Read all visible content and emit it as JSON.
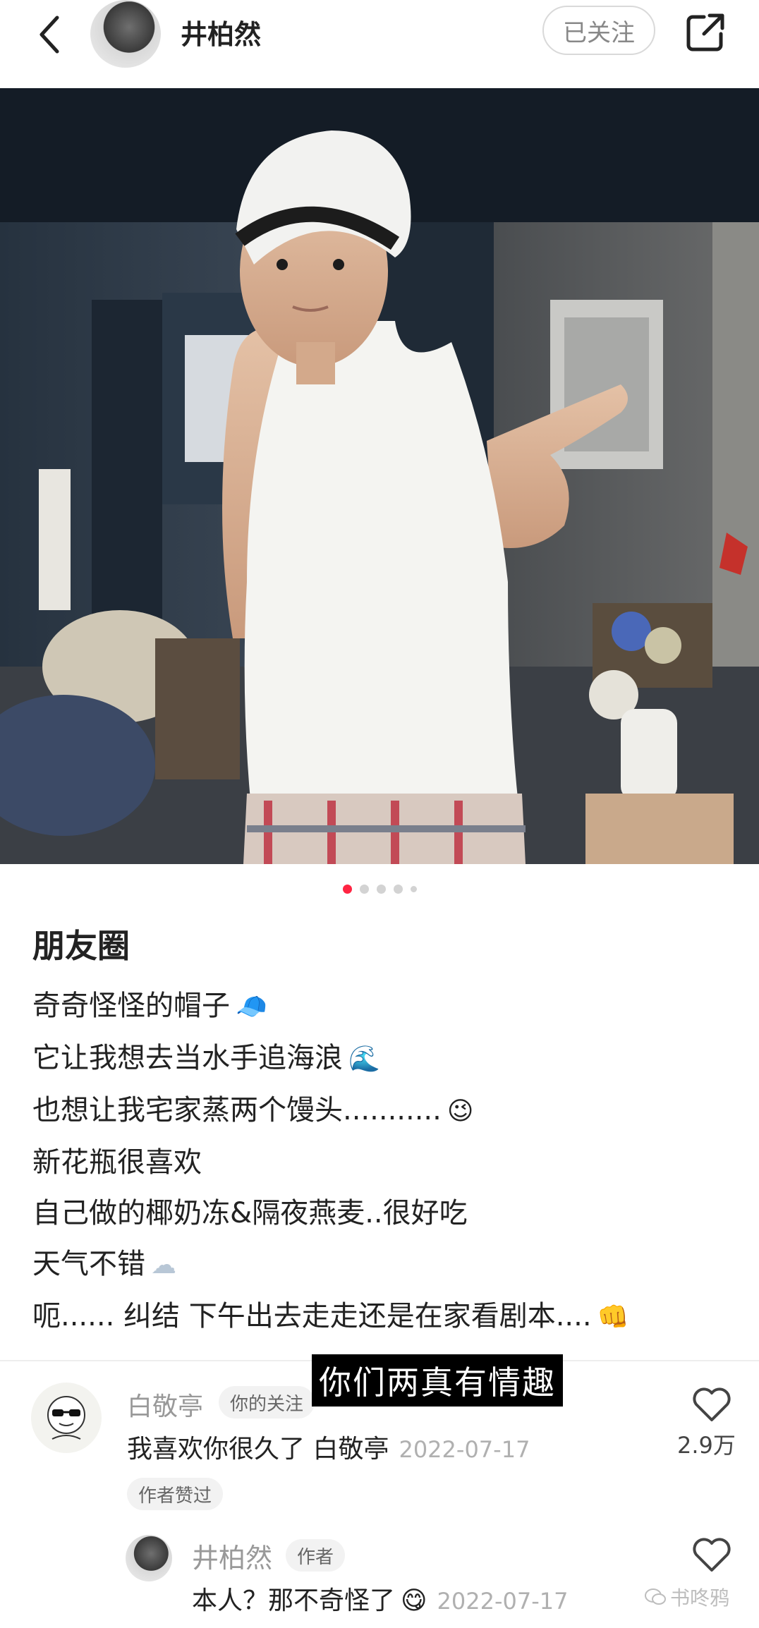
{
  "header": {
    "back_icon": "chevron-left-icon",
    "author_name": "井柏然",
    "follow_label": "已关注",
    "share_icon": "share-icon"
  },
  "photo": {
    "description_icon": "post-photo",
    "carousel_count": 5,
    "carousel_active": 1
  },
  "post": {
    "title": "朋友圈",
    "lines": [
      {
        "text": "奇奇怪怪的帽子",
        "emoji": "🧢"
      },
      {
        "text": "它让我想去当水手追海浪",
        "emoji": "🌊"
      },
      {
        "text": "也想让我宅家蒸两个馒头...........",
        "emoji": "😉"
      },
      {
        "text": "新花瓶很喜欢",
        "emoji": ""
      },
      {
        "text": "自己做的椰奶冻&隔夜燕麦..很好吃",
        "emoji": ""
      },
      {
        "text": "天气不错",
        "emoji": "☁"
      },
      {
        "text": "呃...... 纠结 下午出去走走还是在家看剧本....",
        "emoji": "👊"
      }
    ]
  },
  "subtitle": "你们两真有情趣",
  "comments": [
    {
      "name": "白敬亭",
      "tag": "你的关注",
      "text": "我喜欢你很久了 白敬亭",
      "date": "2022-07-17",
      "like_count": "2.9万",
      "badge": "作者赞过"
    }
  ],
  "reply": {
    "name": "井柏然",
    "tag": "作者",
    "text": "本人？那不奇怪了",
    "emoji": "😋",
    "date": "2022-07-17"
  },
  "watermark": "书咚鸦",
  "colors": {
    "accent": "#ff2442",
    "muted": "#999999"
  }
}
